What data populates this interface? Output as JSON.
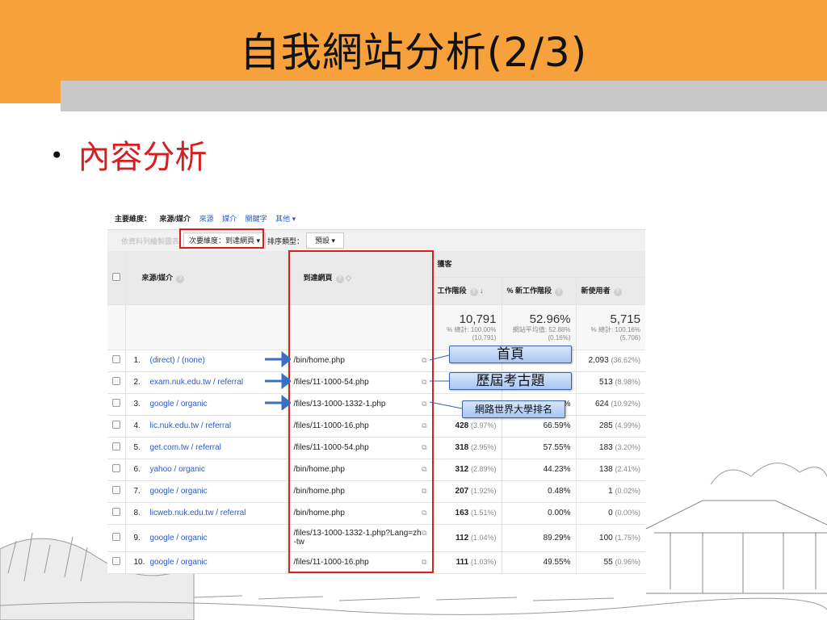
{
  "slide": {
    "title": "自我網站分析(2/3)",
    "bullet": "內容分析"
  },
  "colors": {
    "accent_orange": "#f7a13c",
    "band_gray": "#c8c8c8",
    "highlight_red": "#d42020",
    "link_blue": "#2a59c9"
  },
  "dimensions": {
    "primary_label": "主要維度：",
    "items": [
      "來源/媒介",
      "來源",
      "媒介",
      "關鍵字",
      "其他 ▾"
    ]
  },
  "controls": {
    "ghost": "依資料列繪製圖表",
    "secondary": "次要維度：到達網頁",
    "sort_label": "排序類型：",
    "sort_value": "預設"
  },
  "table": {
    "col_source": "來源/媒介",
    "col_page": "到達網頁",
    "group": "獲客",
    "col_sessions": "工作階段",
    "col_new_pct": "% 新工作階段",
    "col_new_users": "新使用者",
    "totals": {
      "sessions": "10,791",
      "sessions_sub1": "% 總計: 100.00%",
      "sessions_sub2": "(10,791)",
      "new_pct": "52.96%",
      "new_pct_sub1": "網站平均值: 52.88%",
      "new_pct_sub2": "(0.16%)",
      "new_users": "5,715",
      "new_users_sub1": "% 總計: 100.16%",
      "new_users_sub2": "(5,706)"
    },
    "rows": [
      {
        "n": "1.",
        "source": "(direct) / (none)",
        "page": "/bin/home.php",
        "sessions": "",
        "s_pct": "",
        "new_pct": "%",
        "users": "2,093",
        "u_pct": "(36.62%)"
      },
      {
        "n": "2.",
        "source": "exam.nuk.edu.tw / referral",
        "page": "/files/11-1000-54.php",
        "sessions": "",
        "s_pct": "",
        "new_pct": "%",
        "users": "513",
        "u_pct": "(8.98%)"
      },
      {
        "n": "3.",
        "source": "google / organic",
        "page": "/files/13-1000-1332-1.php",
        "sessions": "",
        "s_pct": "",
        "new_pct": "%",
        "users": "624",
        "u_pct": "(10.92%)"
      },
      {
        "n": "4.",
        "source": "lic.nuk.edu.tw / referral",
        "page": "/files/11-1000-16.php",
        "sessions": "428",
        "s_pct": "(3.97%)",
        "new_pct": "66.59%",
        "users": "285",
        "u_pct": "(4.99%)"
      },
      {
        "n": "5.",
        "source": "get.com.tw / referral",
        "page": "/files/11-1000-54.php",
        "sessions": "318",
        "s_pct": "(2.95%)",
        "new_pct": "57.55%",
        "users": "183",
        "u_pct": "(3.20%)"
      },
      {
        "n": "6.",
        "source": "yahoo / organic",
        "page": "/bin/home.php",
        "sessions": "312",
        "s_pct": "(2.89%)",
        "new_pct": "44.23%",
        "users": "138",
        "u_pct": "(2.41%)"
      },
      {
        "n": "7.",
        "source": "google / organic",
        "page": "/bin/home.php",
        "sessions": "207",
        "s_pct": "(1.92%)",
        "new_pct": "0.48%",
        "users": "1",
        "u_pct": "(0.02%)"
      },
      {
        "n": "8.",
        "source": "licweb.nuk.edu.tw / referral",
        "page": "/bin/home.php",
        "sessions": "163",
        "s_pct": "(1.51%)",
        "new_pct": "0.00%",
        "users": "0",
        "u_pct": "(0.00%)"
      },
      {
        "n": "9.",
        "source": "google / organic",
        "page": "/files/13-1000-1332-1.php?Lang=zh-tw",
        "sessions": "112",
        "s_pct": "(1.04%)",
        "new_pct": "89.29%",
        "users": "100",
        "u_pct": "(1.75%)"
      },
      {
        "n": "10.",
        "source": "google / organic",
        "page": "/files/11-1000-16.php",
        "sessions": "111",
        "s_pct": "(1.03%)",
        "new_pct": "49.55%",
        "users": "55",
        "u_pct": "(0.96%)"
      }
    ]
  },
  "callouts": [
    "首頁",
    "歷屆考古題",
    "網路世界大學排名"
  ]
}
